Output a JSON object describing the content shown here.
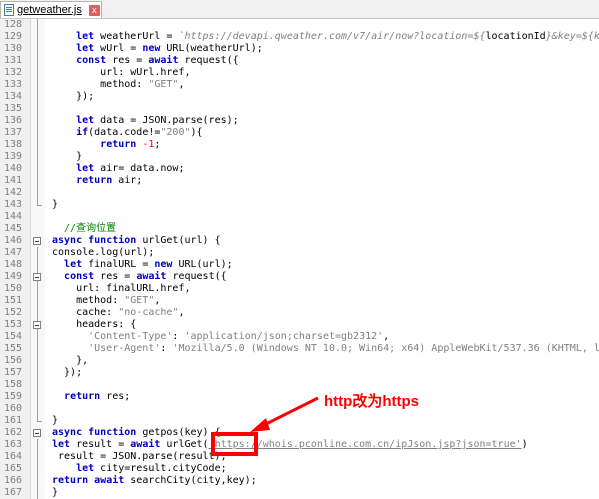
{
  "tab": {
    "label": "getweather.js",
    "close": "x",
    "icon": "file-saved-icon"
  },
  "annotation": {
    "text": "http改为https",
    "color": "#ff0000"
  },
  "lines": [
    {
      "n": "128",
      "parts": []
    },
    {
      "n": "129",
      "parts": [
        [
          "    ",
          ""
        ],
        [
          "let",
          "kw"
        ],
        [
          " weatherUrl = ",
          ""
        ],
        [
          "`https://devapi.qweather.com/v7/air/now?location=${",
          "tpl"
        ],
        [
          "locationId",
          ""
        ],
        [
          "}&key=${k",
          "tpl"
        ]
      ]
    },
    {
      "n": "130",
      "parts": [
        [
          "    ",
          ""
        ],
        [
          "let",
          "kw"
        ],
        [
          " wUrl = ",
          ""
        ],
        [
          "new",
          "kw"
        ],
        [
          " URL(weatherUrl);",
          ""
        ]
      ]
    },
    {
      "n": "131",
      "parts": [
        [
          "    ",
          ""
        ],
        [
          "const",
          "kw"
        ],
        [
          " res = ",
          ""
        ],
        [
          "await",
          "kw"
        ],
        [
          " request({",
          ""
        ]
      ]
    },
    {
      "n": "132",
      "parts": [
        [
          "        url: wUrl.href,",
          ""
        ]
      ]
    },
    {
      "n": "133",
      "parts": [
        [
          "        method: ",
          ""
        ],
        [
          "\"GET\"",
          "str"
        ],
        [
          ",",
          ""
        ]
      ]
    },
    {
      "n": "134",
      "parts": [
        [
          "    });",
          ""
        ]
      ]
    },
    {
      "n": "135",
      "parts": []
    },
    {
      "n": "136",
      "parts": [
        [
          "    ",
          ""
        ],
        [
          "let",
          "kw"
        ],
        [
          " data = JSON.parse(res);",
          ""
        ]
      ]
    },
    {
      "n": "137",
      "parts": [
        [
          "    ",
          ""
        ],
        [
          "if",
          "kw"
        ],
        [
          "(data.code!=",
          ""
        ],
        [
          "\"200\"",
          "str"
        ],
        [
          "){",
          ""
        ]
      ]
    },
    {
      "n": "138",
      "parts": [
        [
          "        ",
          ""
        ],
        [
          "return",
          "kw"
        ],
        [
          " ",
          ""
        ],
        [
          "-1",
          "num"
        ],
        [
          ";",
          ""
        ]
      ]
    },
    {
      "n": "139",
      "parts": [
        [
          "    }",
          ""
        ]
      ]
    },
    {
      "n": "140",
      "parts": [
        [
          "    ",
          ""
        ],
        [
          "let",
          "kw"
        ],
        [
          " air= data.now;",
          ""
        ]
      ]
    },
    {
      "n": "141",
      "parts": [
        [
          "    ",
          ""
        ],
        [
          "return",
          "kw"
        ],
        [
          " air;",
          ""
        ]
      ]
    },
    {
      "n": "142",
      "parts": []
    },
    {
      "n": "143",
      "parts": [
        [
          "}",
          ""
        ]
      ]
    },
    {
      "n": "144",
      "parts": []
    },
    {
      "n": "145",
      "parts": [
        [
          "  //查询位置",
          "cmt"
        ]
      ]
    },
    {
      "n": "146",
      "parts": [
        [
          "async",
          "kw"
        ],
        [
          " ",
          ""
        ],
        [
          "function",
          "kw"
        ],
        [
          " urlGet(url) {",
          ""
        ]
      ]
    },
    {
      "n": "147",
      "parts": [
        [
          "console.log(url);",
          ""
        ]
      ]
    },
    {
      "n": "148",
      "parts": [
        [
          "  ",
          ""
        ],
        [
          "let",
          "kw"
        ],
        [
          " finalURL = ",
          ""
        ],
        [
          "new",
          "kw"
        ],
        [
          " URL(url);",
          ""
        ]
      ]
    },
    {
      "n": "149",
      "parts": [
        [
          "  ",
          ""
        ],
        [
          "const",
          "kw"
        ],
        [
          " res = ",
          ""
        ],
        [
          "await",
          "kw"
        ],
        [
          " request({",
          ""
        ]
      ]
    },
    {
      "n": "150",
      "parts": [
        [
          "    url: finalURL.href,",
          ""
        ]
      ]
    },
    {
      "n": "151",
      "parts": [
        [
          "    method: ",
          ""
        ],
        [
          "\"GET\"",
          "str"
        ],
        [
          ",",
          ""
        ]
      ]
    },
    {
      "n": "152",
      "parts": [
        [
          "    cache: ",
          ""
        ],
        [
          "\"no-cache\"",
          "str"
        ],
        [
          ",",
          ""
        ]
      ]
    },
    {
      "n": "153",
      "parts": [
        [
          "    headers: {",
          ""
        ]
      ]
    },
    {
      "n": "154",
      "parts": [
        [
          "      ",
          ""
        ],
        [
          "'Content-Type'",
          "str"
        ],
        [
          ": ",
          ""
        ],
        [
          "'application/json;charset=gb2312'",
          "str"
        ],
        [
          ",",
          ""
        ]
      ]
    },
    {
      "n": "155",
      "parts": [
        [
          "      ",
          ""
        ],
        [
          "'User-Agent'",
          "str"
        ],
        [
          ": ",
          ""
        ],
        [
          "'Mozilla/5.0 (Windows NT 10.0; Win64; x64) AppleWebKit/537.36 (KHTML, l",
          "str"
        ]
      ]
    },
    {
      "n": "156",
      "parts": [
        [
          "    },",
          ""
        ]
      ]
    },
    {
      "n": "157",
      "parts": [
        [
          "  });",
          ""
        ]
      ]
    },
    {
      "n": "158",
      "parts": []
    },
    {
      "n": "159",
      "parts": [
        [
          "  ",
          ""
        ],
        [
          "return",
          "kw"
        ],
        [
          " res;",
          ""
        ]
      ]
    },
    {
      "n": "160",
      "parts": []
    },
    {
      "n": "161",
      "parts": [
        [
          "}",
          ""
        ]
      ]
    },
    {
      "n": "162",
      "parts": [
        [
          "async",
          "kw"
        ],
        [
          " ",
          ""
        ],
        [
          "function",
          "kw"
        ],
        [
          " getpos(key) {",
          ""
        ]
      ]
    },
    {
      "n": "163",
      "parts": [
        [
          "let",
          "kw"
        ],
        [
          " result = ",
          ""
        ],
        [
          "await",
          "kw"
        ],
        [
          " urlGet(",
          ""
        ],
        [
          "'https://whois.pconline.com.cn/ipJson.jsp?json=true'",
          "url"
        ],
        [
          ")",
          ""
        ]
      ]
    },
    {
      "n": "164",
      "parts": [
        [
          " result = JSON.parse(result);",
          ""
        ]
      ]
    },
    {
      "n": "165",
      "parts": [
        [
          "    ",
          ""
        ],
        [
          "let",
          "kw"
        ],
        [
          " city=result.cityCode;",
          ""
        ]
      ]
    },
    {
      "n": "166",
      "parts": [
        [
          "return",
          "kw"
        ],
        [
          " ",
          ""
        ],
        [
          "await",
          "kw"
        ],
        [
          " searchCity(city,key);",
          ""
        ]
      ]
    },
    {
      "n": "167",
      "parts": [
        [
          "}",
          ""
        ]
      ]
    }
  ]
}
